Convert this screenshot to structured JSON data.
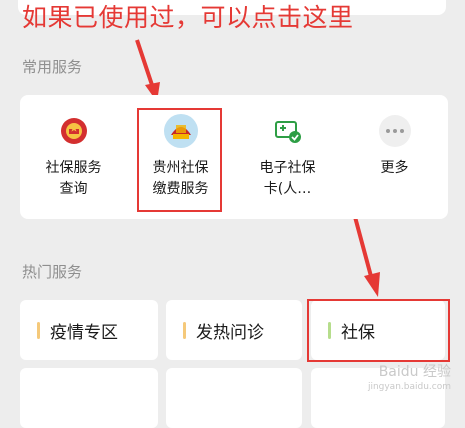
{
  "annotation": {
    "text": "如果已使用过，可以点击这里",
    "color": "#e53935"
  },
  "common_services": {
    "title": "常用服务",
    "items": [
      {
        "label": "社保服务\n查询",
        "icon": "national-emblem-icon"
      },
      {
        "label": "贵州社保\n缴费服务",
        "icon": "guizhou-social-security-logo-icon"
      },
      {
        "label": "电子社保\n卡(人…",
        "icon": "social-security-card-icon"
      },
      {
        "label": "更多",
        "icon": "more-icon"
      }
    ]
  },
  "hot_services": {
    "title": "热门服务",
    "items": [
      {
        "label": "疫情专区",
        "accent": "#f5c97a"
      },
      {
        "label": "发热问诊",
        "accent": "#f5c97a"
      },
      {
        "label": "社保",
        "accent": "#b6dd8c"
      }
    ]
  },
  "watermark": {
    "brand": "Baidu 经验",
    "url": "jingyan.baidu.com"
  }
}
